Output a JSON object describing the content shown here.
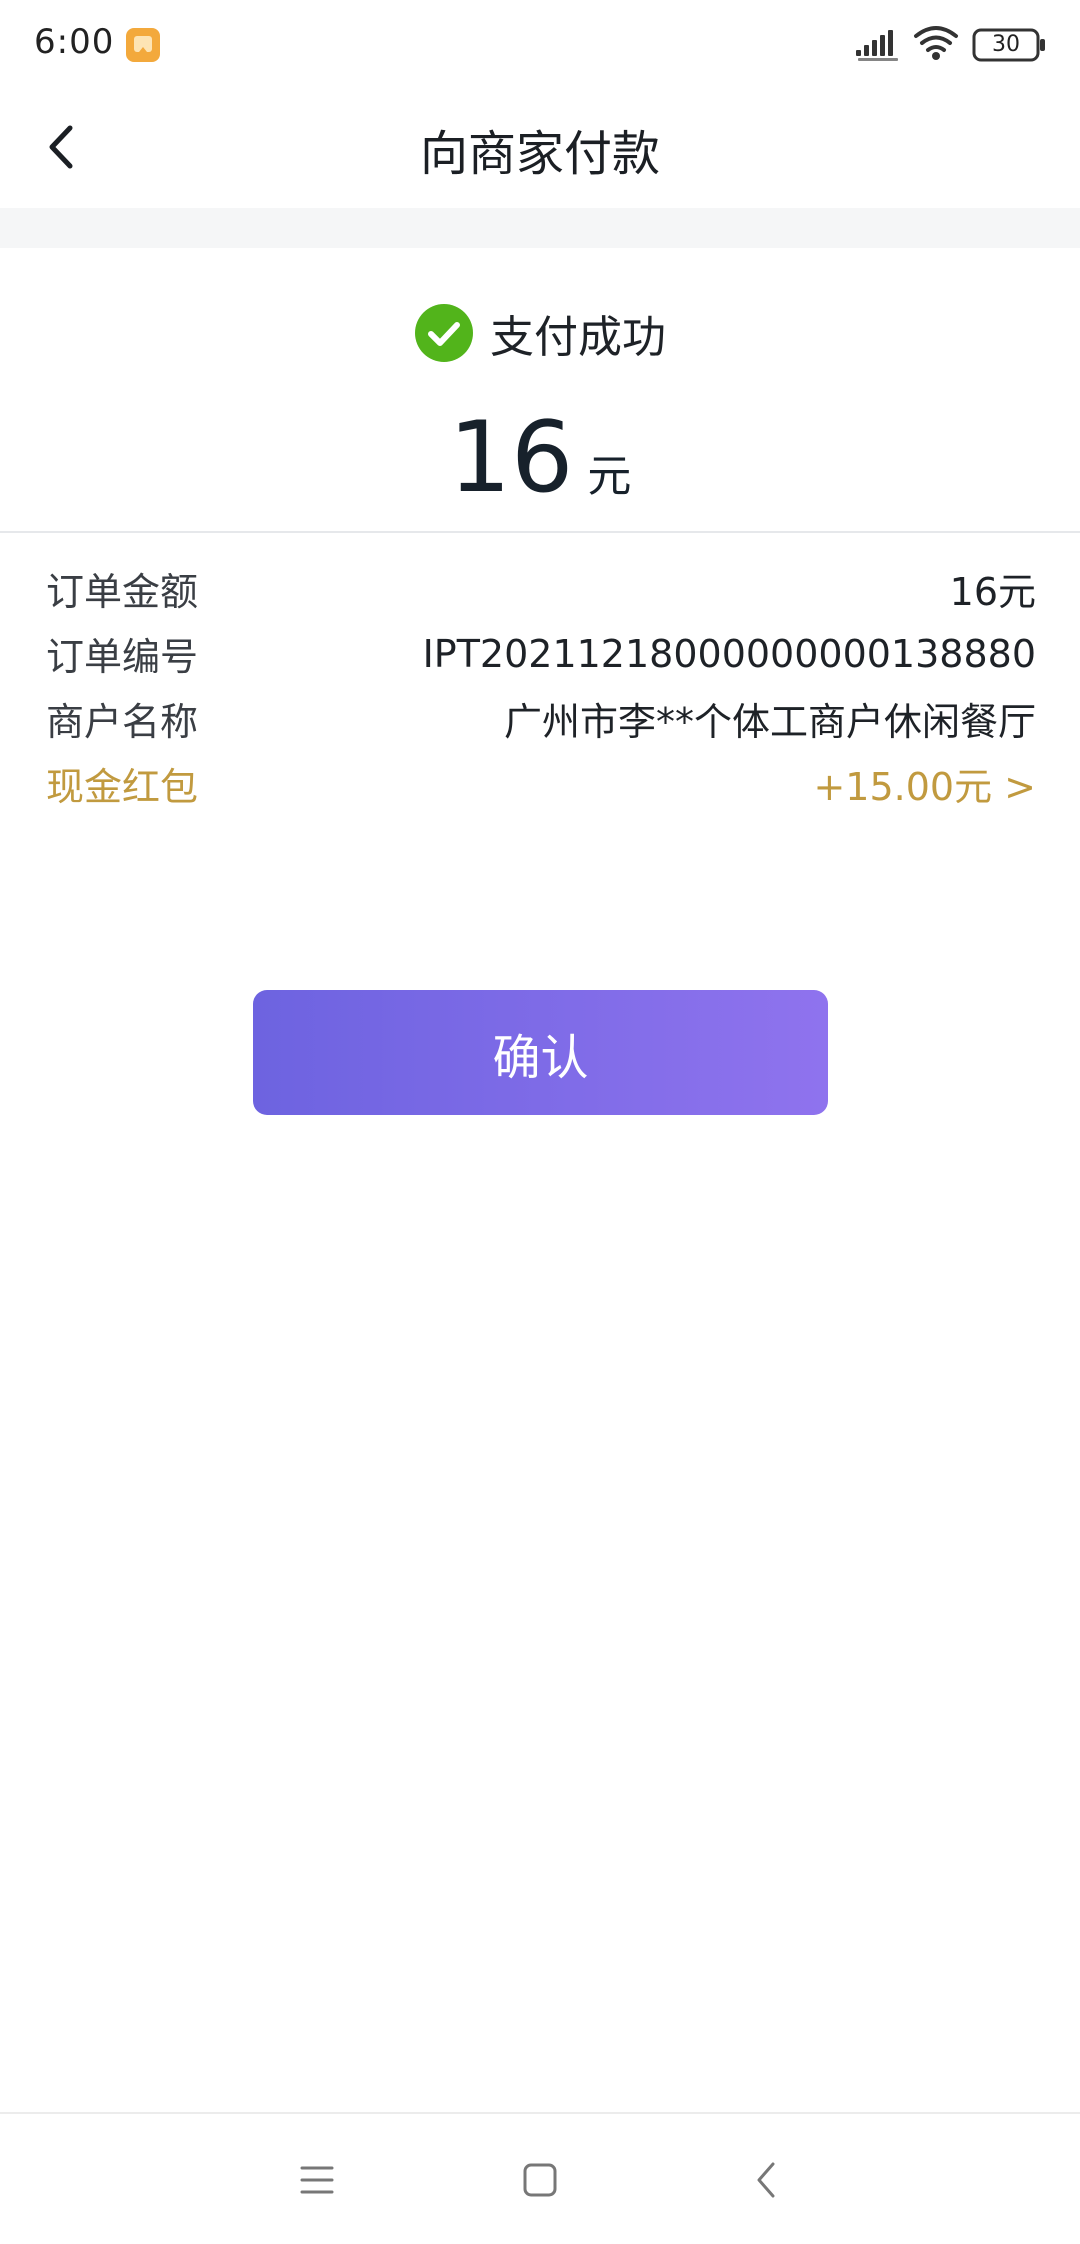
{
  "status_bar": {
    "time": "6:00",
    "battery": "30",
    "icons": [
      "notification-icon",
      "signal-icon",
      "wifi-icon",
      "battery-icon"
    ]
  },
  "header": {
    "title": "向商家付款",
    "back_icon": "chevron-left-icon"
  },
  "result": {
    "status_text": "支付成功",
    "status_icon": "check-circle-icon",
    "amount": "16",
    "unit": "元"
  },
  "details": [
    {
      "label": "订单金额",
      "value": "16元"
    },
    {
      "label": "订单编号",
      "value": "IPT20211218000000000138880"
    },
    {
      "label": "商户名称",
      "value": "广州市李**个体工商户休闲餐厅"
    },
    {
      "label": "现金红包",
      "value": "+15.00元 >"
    }
  ],
  "confirm_button": "确认",
  "system_nav": [
    "menu-icon",
    "home-icon",
    "back-icon"
  ],
  "colors": {
    "accent_start": "#6d63e0",
    "accent_end": "#8f73ee",
    "success": "#52b41b",
    "gold": "#c19a3f"
  }
}
